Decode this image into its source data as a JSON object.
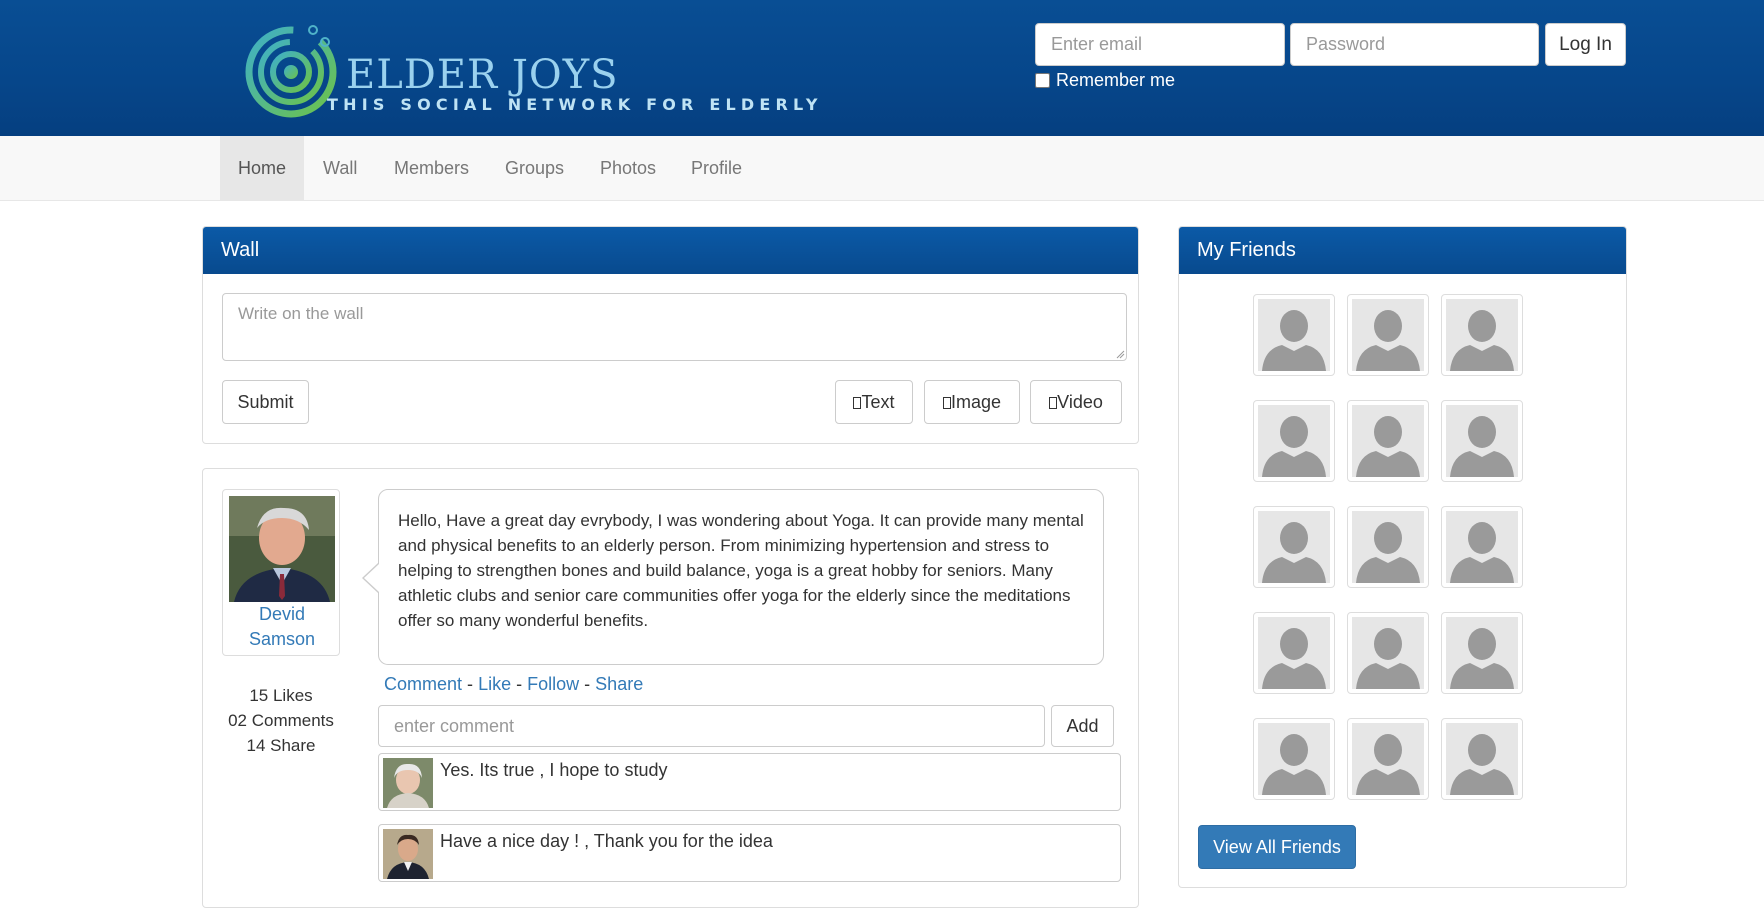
{
  "brand": {
    "title": "ELDER JOYS",
    "tagline": "THIS SOCIAL NETWORK FOR ELDERLY",
    "accent": "#094e94"
  },
  "login": {
    "email_placeholder": "Enter email",
    "password_placeholder": "Password",
    "login_label": "Log In",
    "remember_label": "Remember me"
  },
  "nav": {
    "items": [
      {
        "label": "Home",
        "active": true
      },
      {
        "label": "Wall"
      },
      {
        "label": "Members"
      },
      {
        "label": "Groups"
      },
      {
        "label": "Photos"
      },
      {
        "label": "Profile"
      }
    ]
  },
  "wall": {
    "title": "Wall",
    "placeholder": "Write on the wall",
    "submit_label": "Submit",
    "text_label": "Text",
    "image_label": "Image",
    "video_label": "Video"
  },
  "post": {
    "author_first": "Devid",
    "author_last": "Samson",
    "likes": "15 Likes",
    "comments": "02 Comments",
    "shares": "14 Share",
    "body": "Hello, Have a great day evrybody, I was wondering about Yoga. It can provide many mental and physical benefits to an elderly person. From minimizing hypertension and stress to helping to strengthen bones and build balance, yoga is a great hobby for seniors. Many athletic clubs and senior care communities offer yoga for the elderly since the meditations offer so many wonderful benefits.",
    "actions": {
      "comment": "Comment",
      "like": "Like",
      "follow": "Follow",
      "share": "Share",
      "separator": "-"
    },
    "comment_placeholder": "enter comment",
    "add_label": "Add",
    "comments_list": [
      {
        "text": "Yes. Its true , I hope to study"
      },
      {
        "text": "Have a nice day ! , Thank you for the idea"
      }
    ]
  },
  "friends": {
    "title": "My Friends",
    "count": 15,
    "view_all_label": "View All Friends"
  }
}
